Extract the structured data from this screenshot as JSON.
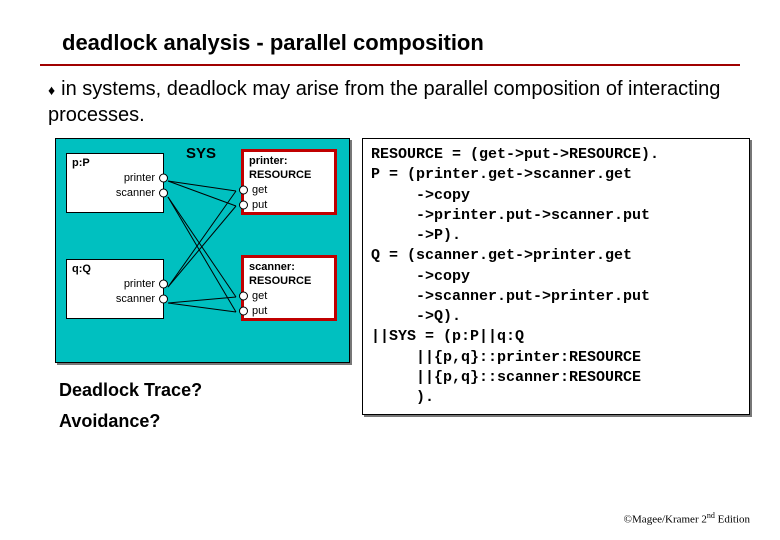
{
  "title": "deadlock analysis - parallel composition",
  "body": "in systems, deadlock may arise from the parallel composition of interacting processes.",
  "diagram": {
    "sys": "SYS",
    "p": {
      "header": "p:P",
      "ports": [
        "printer",
        "scanner"
      ]
    },
    "q": {
      "header": "q:Q",
      "ports": [
        "printer",
        "scanner"
      ]
    },
    "printer": {
      "header": "printer:",
      "sub": "RESOURCE",
      "ports": [
        "get",
        "put"
      ]
    },
    "scanner": {
      "header": "scanner:",
      "sub": "RESOURCE",
      "ports": [
        "get",
        "put"
      ]
    }
  },
  "questions": {
    "q1": "Deadlock Trace?",
    "q2": "Avoidance?"
  },
  "code": "RESOURCE = (get->put->RESOURCE).\nP = (printer.get->scanner.get\n     ->copy\n     ->printer.put->scanner.put\n     ->P).\nQ = (scanner.get->printer.get\n     ->copy\n     ->scanner.put->printer.put\n     ->Q).\n||SYS = (p:P||q:Q\n     ||{p,q}::printer:RESOURCE\n     ||{p,q}::scanner:RESOURCE\n     ).",
  "footer": {
    "pre": "©Magee/Kramer ",
    "ed": "2",
    "suf": " Edition"
  }
}
